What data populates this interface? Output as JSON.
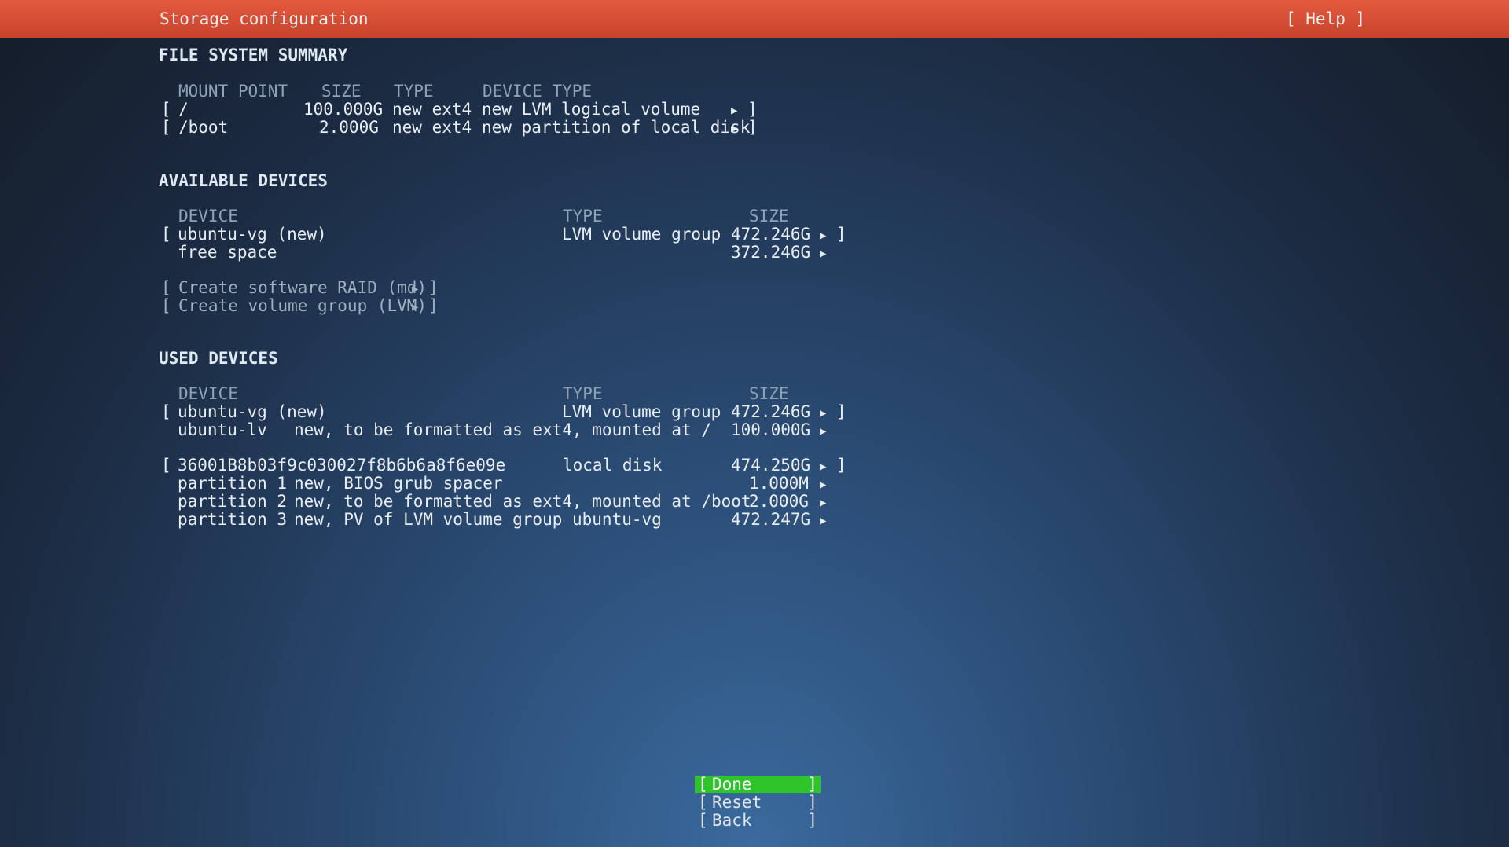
{
  "header": {
    "title": "Storage configuration",
    "help": "[ Help ]"
  },
  "fs_summary": {
    "heading": "FILE SYSTEM SUMMARY",
    "col_mount": "MOUNT POINT",
    "col_size": "SIZE",
    "col_type": "TYPE",
    "col_devtype": "DEVICE TYPE",
    "rows": [
      {
        "mount": "/",
        "size": "100.000G",
        "type": "new ext4",
        "devtype": "new LVM logical volume"
      },
      {
        "mount": "/boot",
        "size": "2.000G",
        "type": "new ext4",
        "devtype": "new partition of local disk"
      }
    ]
  },
  "available": {
    "heading": "AVAILABLE DEVICES",
    "col_device": "DEVICE",
    "col_type": "TYPE",
    "col_size": "SIZE",
    "vg_name": "ubuntu-vg (new)",
    "vg_type": "LVM volume group",
    "vg_size": "472.246G",
    "free_label": "free space",
    "free_size": "372.246G",
    "actions": [
      "Create software RAID (md)",
      "Create volume group (LVM)"
    ]
  },
  "used": {
    "heading": "USED DEVICES",
    "col_device": "DEVICE",
    "col_type": "TYPE",
    "col_size": "SIZE",
    "vg_name": "ubuntu-vg (new)",
    "vg_type": "LVM volume group",
    "vg_size": "472.246G",
    "lv_name": "ubuntu-lv",
    "lv_desc": "new, to be formatted as ext4, mounted at /",
    "lv_size": "100.000G",
    "disk_name": "36001B8b03f9c030027f8b6b6a8f6e09e",
    "disk_type": "local disk",
    "disk_size": "474.250G",
    "partitions": [
      {
        "name": "partition 1",
        "desc": "new, BIOS grub spacer",
        "size": "1.000M"
      },
      {
        "name": "partition 2",
        "desc": "new, to be formatted as ext4, mounted at /boot",
        "size": "2.000G"
      },
      {
        "name": "partition 3",
        "desc": "new, PV of LVM volume group ubuntu-vg",
        "size": "472.247G"
      }
    ]
  },
  "buttons": {
    "done": "Done",
    "reset": "Reset",
    "back": "Back"
  },
  "glyphs": {
    "arrow": "▶",
    "open": "[",
    "close": "]"
  },
  "colors": {
    "titlebar": "#e35a3e",
    "done_button": "#2ec42a"
  }
}
